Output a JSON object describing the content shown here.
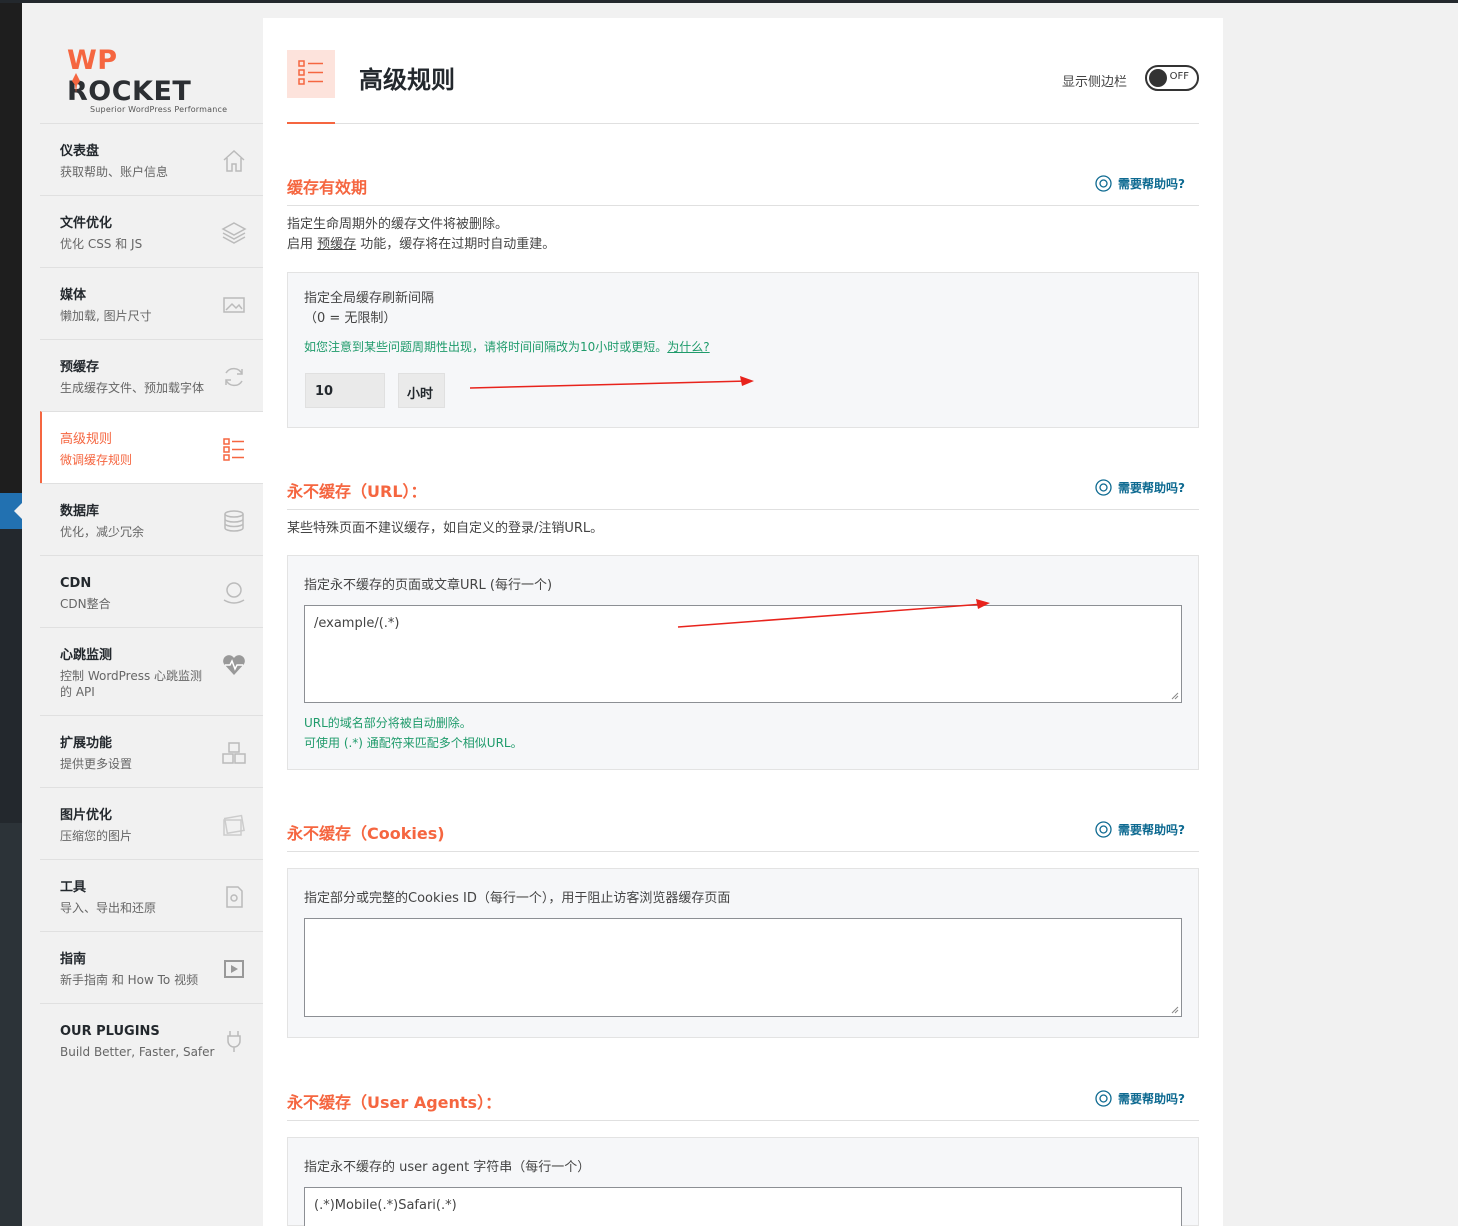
{
  "brand": {
    "logo_wp": "WP",
    "logo_rocket": "ROCKET",
    "tagline": "Superior WordPress Performance"
  },
  "nav": [
    {
      "title": "仪表盘",
      "sub": "获取帮助、账户信息",
      "icon": "home-icon"
    },
    {
      "title": "文件优化",
      "sub": "优化 CSS 和 JS",
      "icon": "layers-icon"
    },
    {
      "title": "媒体",
      "sub": "懒加载, 图片尺寸",
      "icon": "image-icon"
    },
    {
      "title": "预缓存",
      "sub": "生成缓存文件、预加载字体",
      "icon": "refresh-icon"
    },
    {
      "title": "高级规则",
      "sub": "微调缓存规则",
      "icon": "checklist-icon"
    },
    {
      "title": "数据库",
      "sub": "优化，减少冗余",
      "icon": "database-icon"
    },
    {
      "title": "CDN",
      "sub": "CDN整合",
      "icon": "globe-hand-icon"
    },
    {
      "title": "心跳监测",
      "sub": "控制 WordPress 心跳监测的 API",
      "icon": "heartbeat-icon"
    },
    {
      "title": "扩展功能",
      "sub": "提供更多设置",
      "icon": "cubes-icon"
    },
    {
      "title": "图片优化",
      "sub": "压缩您的图片",
      "icon": "photos-icon"
    },
    {
      "title": "工具",
      "sub": "导入、导出和还原",
      "icon": "file-gear-icon"
    },
    {
      "title": "指南",
      "sub": "新手指南 和 How To 视频",
      "icon": "video-icon"
    },
    {
      "title": "OUR PLUGINS",
      "sub": "Build Better, Faster, Safer",
      "icon": "plug-icon"
    }
  ],
  "header": {
    "title": "高级规则",
    "sidebar_label": "显示侧边栏",
    "toggle_state": "OFF"
  },
  "help_label": "需要帮助吗?",
  "cache_lifespan": {
    "title": "缓存有效期",
    "desc_line1": "指定生命周期外的缓存文件将被删除。",
    "desc_prefix": "启用 ",
    "desc_link": "预缓存",
    "desc_suffix": " 功能，缓存将在过期时自动重建。",
    "label_line1": "指定全局缓存刷新间隔",
    "label_line2": "（0 = 无限制）",
    "note": "如您注意到某些问题周期性出现，请将时间间隔改为10小时或更短。",
    "note_link": "为什么? ",
    "value": "10",
    "unit": "小时"
  },
  "never_cache_url": {
    "title": "永不缓存（URL）：",
    "desc": "某些特殊页面不建议缓存，如自定义的登录/注销URL。",
    "label": "指定永不缓存的页面或文章URL (每行一个)",
    "value": "/example/(.*)",
    "hint1": "URL的域名部分将被自动删除。",
    "hint2": "可使用 (.*) 通配符来匹配多个相似URL。"
  },
  "never_cache_cookies": {
    "title": "永不缓存（Cookies)",
    "label": "指定部分或完整的Cookies ID（每行一个），用于阻止访客浏览器缓存页面",
    "value": ""
  },
  "never_cache_ua": {
    "title": "永不缓存（User Agents）：",
    "label": "指定永不缓存的 user agent 字符串（每行一个）",
    "value": "(.*)Mobile(.*)Safari(.*)"
  },
  "colors": {
    "accent": "#f56640",
    "help": "#0e6a91",
    "note": "#1f9b6b",
    "annotation_arrow": "#e8231c"
  }
}
